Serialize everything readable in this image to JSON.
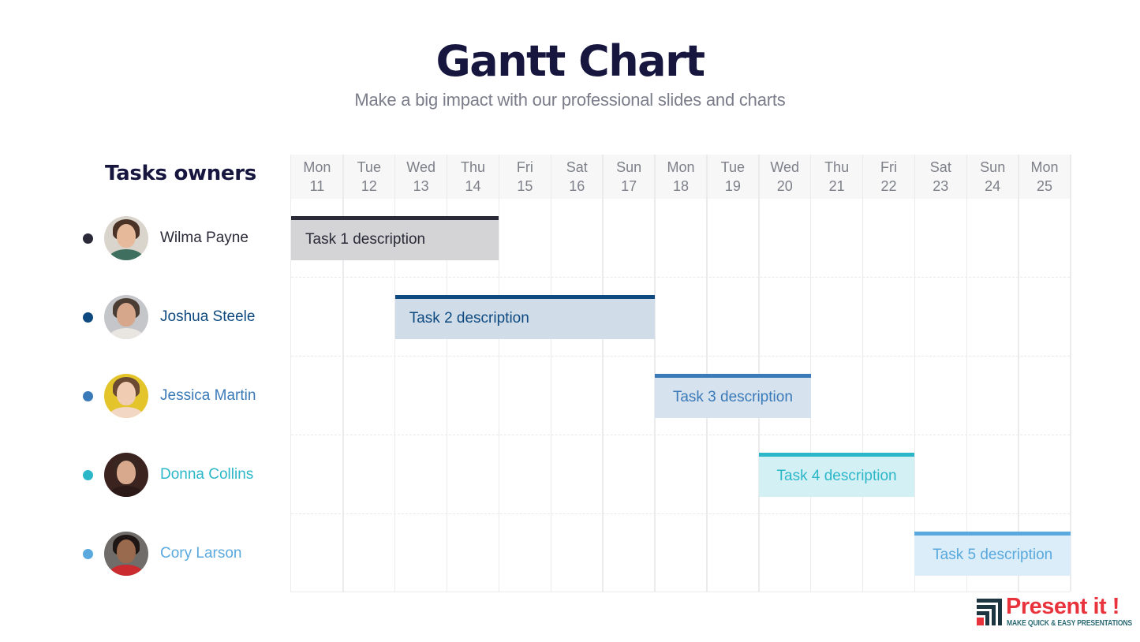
{
  "title": "Gantt Chart",
  "subtitle": "Make a big impact with our professional slides and charts",
  "owners_title": "Tasks owners",
  "owners": [
    {
      "name": "Wilma Payne",
      "color": "#2a2a38",
      "avatar": {
        "bg": "#d9d4cc",
        "hair": "#4a3326",
        "skin": "#e6b99a",
        "shirt": "#3f6f5f"
      }
    },
    {
      "name": "Joshua Steele",
      "color": "#0e4a80",
      "avatar": {
        "bg": "#c4c6c9",
        "hair": "#4b3d33",
        "skin": "#d6a78b",
        "shirt": "#e9e6e2"
      }
    },
    {
      "name": "Jessica Martin",
      "color": "#3b7ab8",
      "avatar": {
        "bg": "#e3c52b",
        "hair": "#6b4a33",
        "skin": "#f0ccb3",
        "shirt": "#f2d7c4"
      }
    },
    {
      "name": "Donna Collins",
      "color": "#2cb7c9",
      "avatar": {
        "bg": "#3b2320",
        "hair": "#3a2620",
        "skin": "#d9a98d",
        "shirt": "#2b1a18"
      }
    },
    {
      "name": "Cory Larson",
      "color": "#5aa9de",
      "avatar": {
        "bg": "#6f6c6a",
        "hair": "#1d1614",
        "skin": "#9a6a4e",
        "shirt": "#c92b2f"
      }
    }
  ],
  "colors": {
    "grid_line": "#ebebed",
    "header_bg": "#f7f7f8",
    "day_text": "#7e8089"
  },
  "chart_data": {
    "type": "gantt",
    "title": "Gantt Chart",
    "subtitle": "Make a big impact with our professional slides and charts",
    "days": [
      {
        "dow": "Mon",
        "date": "11"
      },
      {
        "dow": "Tue",
        "date": "12"
      },
      {
        "dow": "Wed",
        "date": "13"
      },
      {
        "dow": "Thu",
        "date": "14"
      },
      {
        "dow": "Fri",
        "date": "15"
      },
      {
        "dow": "Sat",
        "date": "16"
      },
      {
        "dow": "Sun",
        "date": "17"
      },
      {
        "dow": "Mon",
        "date": "18"
      },
      {
        "dow": "Tue",
        "date": "19"
      },
      {
        "dow": "Wed",
        "date": "20"
      },
      {
        "dow": "Thu",
        "date": "21"
      },
      {
        "dow": "Fri",
        "date": "22"
      },
      {
        "dow": "Sat",
        "date": "23"
      },
      {
        "dow": "Sun",
        "date": "24"
      },
      {
        "dow": "Mon",
        "date": "25"
      }
    ],
    "tasks": [
      {
        "label": "Task 1 description",
        "owner": "Wilma Payne",
        "start": "Mon 11",
        "end": "Thu 14",
        "start_index": 0,
        "duration_days": 4,
        "cap_color": "#2a2a38",
        "fill_color": "#d4d4d6",
        "text_color": "#2a2a38"
      },
      {
        "label": "Task 2 description",
        "owner": "Joshua Steele",
        "start": "Wed 13",
        "end": "Sun 17",
        "start_index": 2,
        "duration_days": 5,
        "cap_color": "#0e4a80",
        "fill_color": "#d0dde9",
        "text_color": "#0e4a80"
      },
      {
        "label": "Task 3 description",
        "owner": "Jessica Martin",
        "start": "Mon 18",
        "end": "Tue 19",
        "start_index": 7,
        "duration_days": 3,
        "cap_color": "#3b7ab8",
        "fill_color": "#d6e2ee",
        "text_color": "#3b7ab8"
      },
      {
        "label": "Task 4 description",
        "owner": "Donna Collins",
        "start": "Wed 20",
        "end": "Fri 22",
        "start_index": 9,
        "duration_days": 3,
        "cap_color": "#2cb7c9",
        "fill_color": "#d3f0f4",
        "text_color": "#2cb7c9"
      },
      {
        "label": "Task 5 description",
        "owner": "Cory Larson",
        "start": "Sat 23",
        "end": "Mon 25",
        "start_index": 12,
        "duration_days": 3,
        "cap_color": "#5aa9de",
        "fill_color": "#daedf8",
        "text_color": "#5aa9de"
      }
    ]
  },
  "logo": {
    "brand": "Present it !",
    "tagline": "MAKE QUICK & EASY PRESENTATIONS"
  }
}
